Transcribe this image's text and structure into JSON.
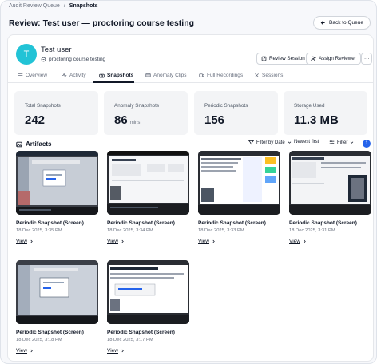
{
  "breadcrumb": {
    "parent": "Audit Review Queue",
    "separator": "/",
    "current": "Snapshots"
  },
  "header": {
    "title": "Review: Test user — proctoring course testing",
    "back_label": "Back to Queue"
  },
  "user": {
    "initial": "T",
    "name": "Test user",
    "course": "proctoring course testing"
  },
  "actions": {
    "review_session": "Review Session",
    "assign_reviewer": "Assign Reviewer",
    "more": "···"
  },
  "tabs": [
    {
      "label": "Overview",
      "icon": "list-icon",
      "active": false
    },
    {
      "label": "Activity",
      "icon": "activity-icon",
      "active": false
    },
    {
      "label": "Snapshots",
      "icon": "camera-icon",
      "active": true
    },
    {
      "label": "Anomaly Clips",
      "icon": "film-icon",
      "active": false
    },
    {
      "label": "Full Recordings",
      "icon": "video-icon",
      "active": false
    },
    {
      "label": "Sessions",
      "icon": "sessions-icon",
      "active": false
    }
  ],
  "stats": [
    {
      "label": "Total Snapshots",
      "value": "242",
      "unit": ""
    },
    {
      "label": "Anomaly Snapshots",
      "value": "86",
      "unit": "mins"
    },
    {
      "label": "Periodic Snapshots",
      "value": "156",
      "unit": ""
    },
    {
      "label": "Storage Used",
      "value": "11.3 MB",
      "unit": ""
    }
  ],
  "artifacts": {
    "title": "Artifacts",
    "filter_by_date": "Filter by Date",
    "sort": "Newest first",
    "filter": "Filter",
    "filter_count": "1"
  },
  "snapshots": [
    {
      "label": "Periodic Snapshot (Screen)",
      "date": "18 Dec 2025, 3:35 PM",
      "view": "View"
    },
    {
      "label": "Periodic Snapshot (Screen)",
      "date": "18 Dec 2025, 3:34 PM",
      "view": "View"
    },
    {
      "label": "Periodic Snapshot (Screen)",
      "date": "18 Dec 2025, 3:33 PM",
      "view": "View"
    },
    {
      "label": "Periodic Snapshot (Screen)",
      "date": "18 Dec 2025, 3:31 PM",
      "view": "View"
    },
    {
      "label": "Periodic Snapshot (Screen)",
      "date": "18 Dec 2025, 3:18 PM",
      "view": "View"
    },
    {
      "label": "Periodic Snapshot (Screen)",
      "date": "18 Dec 2025, 3:17 PM",
      "view": "View"
    }
  ],
  "colors": {
    "accent": "#2563eb",
    "avatar": "#22c3d6",
    "text": "#111827"
  }
}
